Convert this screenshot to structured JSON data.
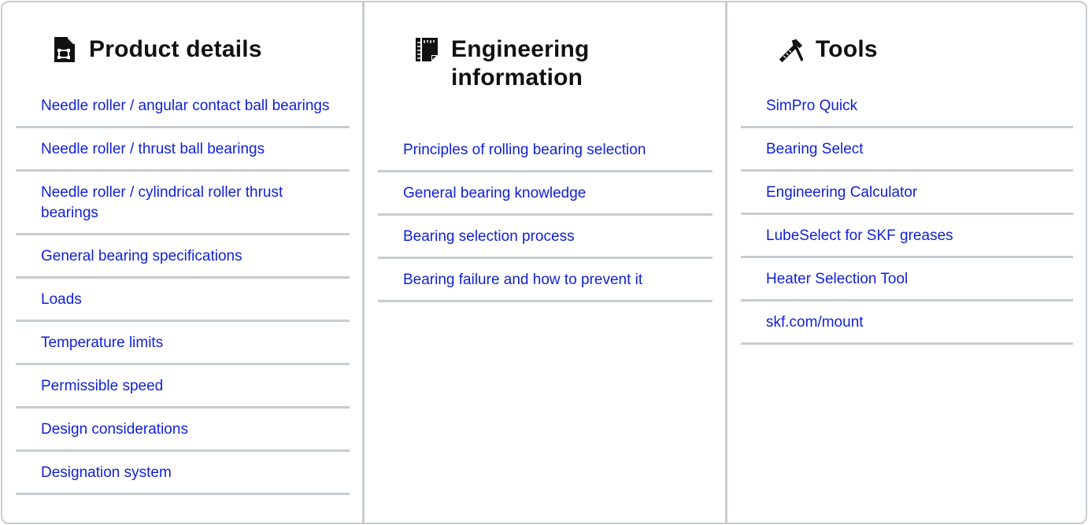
{
  "columns": {
    "product": {
      "title": "Product details",
      "icon": "document-icon",
      "links": [
        "Needle roller / angular contact ball bearings",
        "Needle roller / thrust ball bearings",
        "Needle roller / cylindrical roller thrust bearings",
        "General bearing specifications",
        "Loads",
        "Temperature limits",
        "Permissible speed",
        "Design considerations",
        "Designation system"
      ]
    },
    "engineering": {
      "title": "Engineering information",
      "icon": "notebook-ruler-icon",
      "links": [
        "Principles of rolling bearing selection",
        "General bearing knowledge",
        "Bearing selection process",
        "Bearing failure and how to prevent it"
      ]
    },
    "tools": {
      "title": "Tools",
      "icon": "hammer-ruler-icon",
      "links": [
        "SimPro Quick",
        "Bearing Select",
        "Engineering Calculator",
        "LubeSelect for SKF greases",
        "Heater Selection Tool",
        "skf.com/mount"
      ]
    }
  },
  "colors": {
    "link": "#0f1fd8",
    "title": "#111111",
    "divider": "#c7ccd0"
  }
}
